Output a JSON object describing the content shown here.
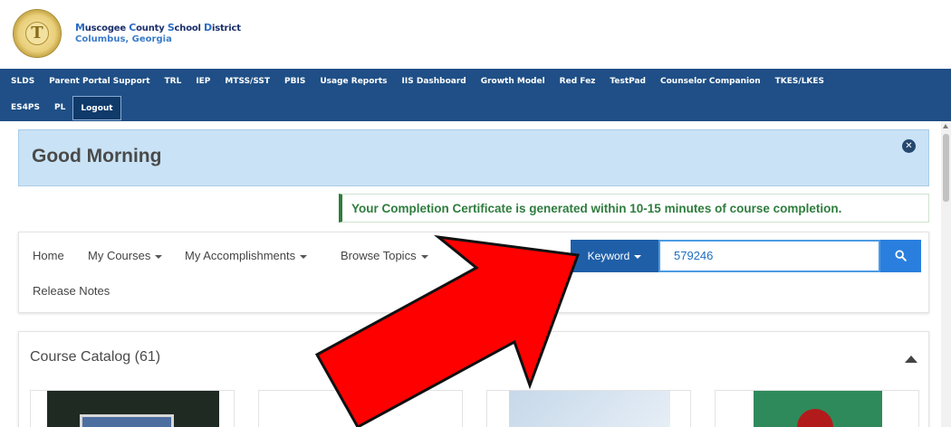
{
  "header": {
    "district_name_parts": [
      "M",
      "uscogee ",
      "C",
      "ounty ",
      "S",
      "chool ",
      "D",
      "istrict"
    ],
    "city": "Columbus, Georgia"
  },
  "nav": {
    "row1": [
      "SLDS",
      "Parent Portal Support",
      "TRL",
      "IEP",
      "MTSS/SST",
      "PBIS",
      "Usage Reports",
      "IIS Dashboard",
      "Growth Model",
      "Red Fez",
      "TestPad",
      "Counselor Companion",
      "TKES/LKES"
    ],
    "row2": [
      "ES4PS",
      "PL",
      "Logout"
    ]
  },
  "greeting": {
    "text": "Good Morning"
  },
  "certificate": {
    "message": "Your Completion Certificate is generated within 10-15 minutes of course completion."
  },
  "menu": {
    "home": "Home",
    "my_courses": "My Courses",
    "my_accomplishments": "My Accomplishments",
    "browse_topics": "Browse Topics",
    "release_notes": "Release Notes"
  },
  "search": {
    "keyword_label": "Keyword",
    "value": "579246"
  },
  "catalog": {
    "title": "Course Catalog (61)"
  },
  "colors": {
    "nav_bg": "#1f4f86",
    "greeting_bg": "#c9e2f5",
    "certificate_accent": "#2f7d3e",
    "search_button": "#2a7fde",
    "overlay_arrow": "#ff0000"
  },
  "icons": {
    "close": "close-circle-icon",
    "search": "search-icon",
    "collapse": "caret-up-icon",
    "logo": "district-seal-logo"
  }
}
